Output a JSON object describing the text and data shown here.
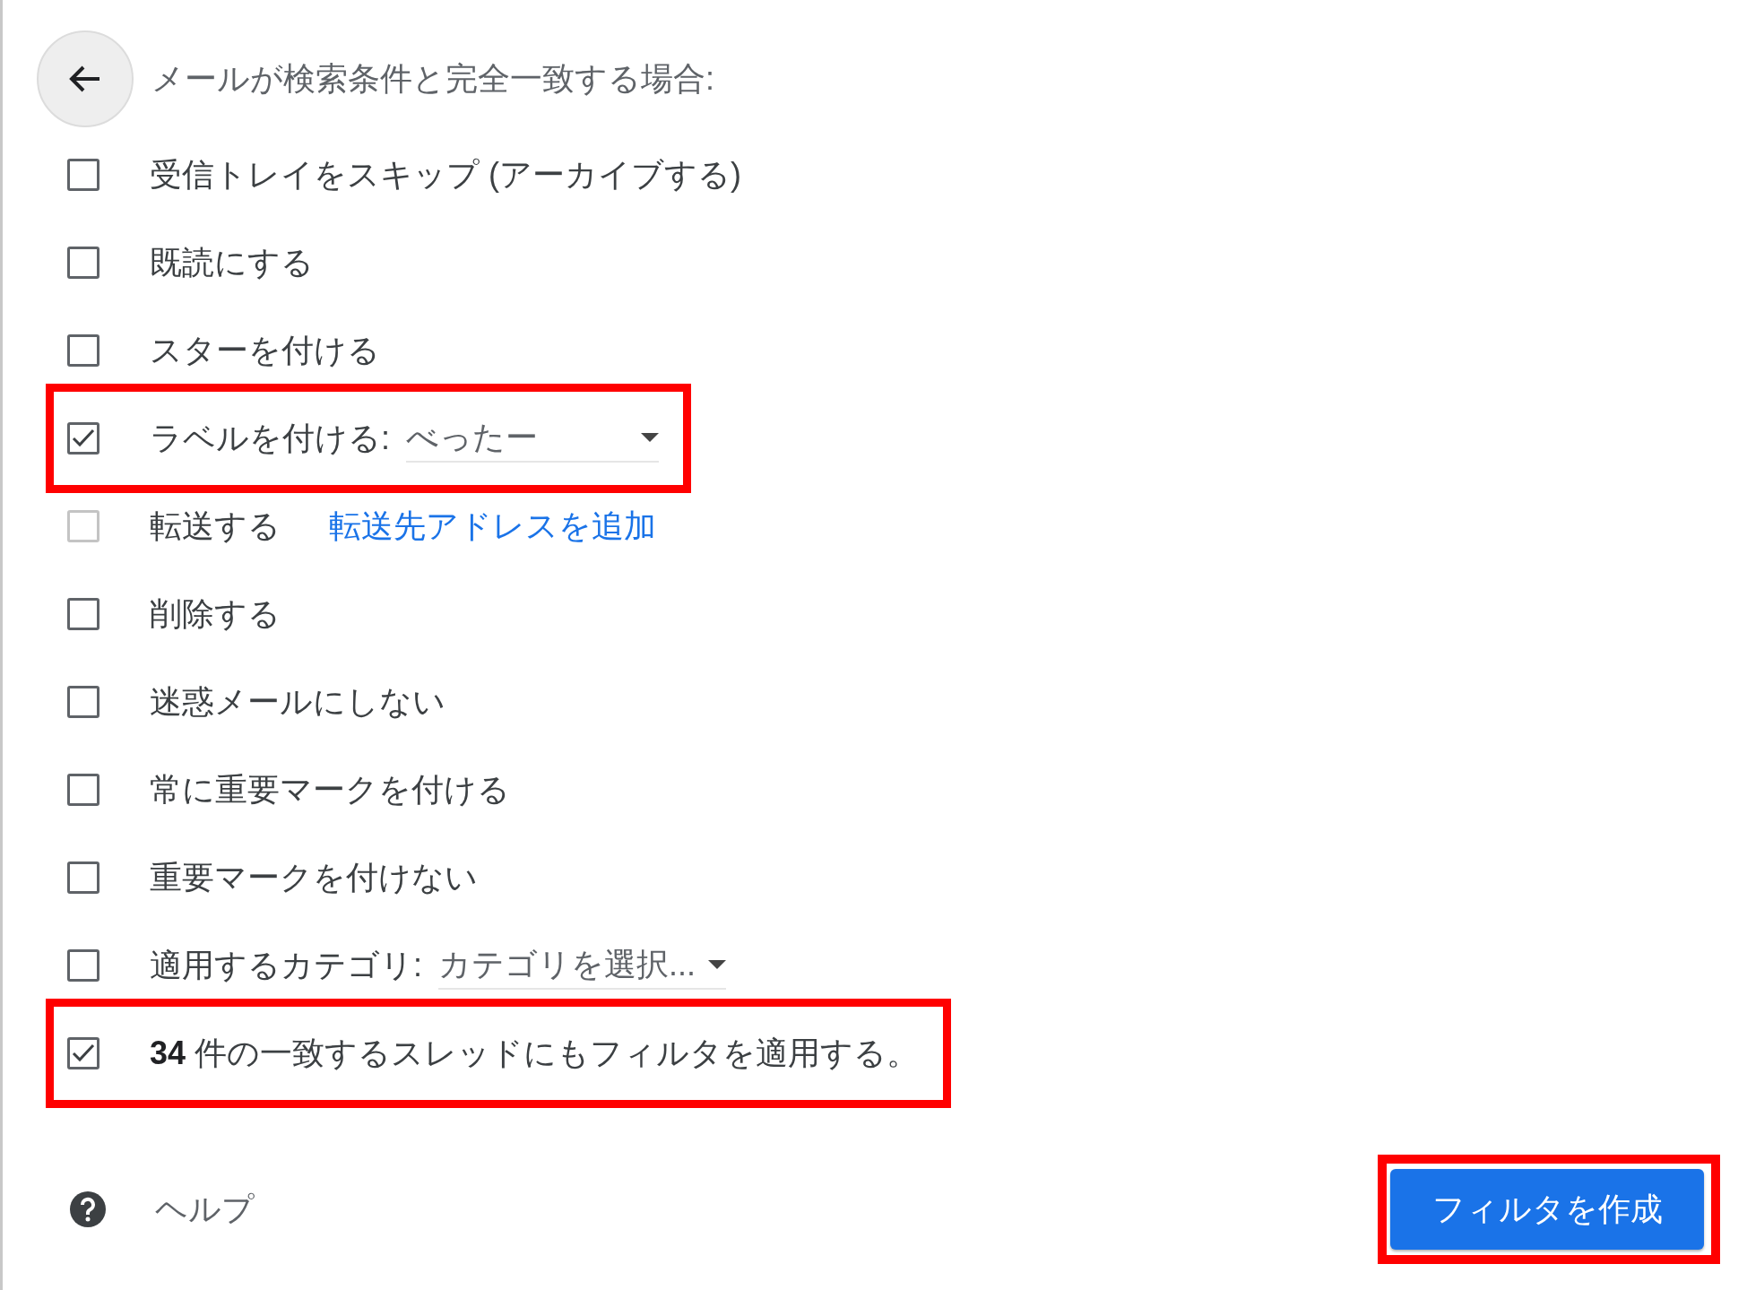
{
  "header": {
    "title": "メールが検索条件と完全一致する場合:"
  },
  "actions": [
    {
      "kind": "checkbox",
      "label": "受信トレイをスキップ (アーカイブする)",
      "checked": false,
      "disabled": false,
      "highlighted": false
    },
    {
      "kind": "checkbox",
      "label": "既読にする",
      "checked": false,
      "disabled": false,
      "highlighted": false
    },
    {
      "kind": "checkbox",
      "label": "スターを付ける",
      "checked": false,
      "disabled": false,
      "highlighted": false
    },
    {
      "kind": "select",
      "label": "ラベルを付ける:",
      "value": "べったー",
      "checked": true,
      "disabled": false,
      "highlighted": true
    },
    {
      "kind": "link",
      "label": "転送する",
      "link": "転送先アドレスを追加",
      "checked": false,
      "disabled": true,
      "highlighted": false
    },
    {
      "kind": "checkbox",
      "label": "削除する",
      "checked": false,
      "disabled": false,
      "highlighted": false
    },
    {
      "kind": "checkbox",
      "label": "迷惑メールにしない",
      "checked": false,
      "disabled": false,
      "highlighted": false
    },
    {
      "kind": "checkbox",
      "label": "常に重要マークを付ける",
      "checked": false,
      "disabled": false,
      "highlighted": false
    },
    {
      "kind": "checkbox",
      "label": "重要マークを付けない",
      "checked": false,
      "disabled": false,
      "highlighted": false
    },
    {
      "kind": "select",
      "label": "適用するカテゴリ:",
      "value": "カテゴリを選択...",
      "checked": false,
      "disabled": false,
      "highlighted": false
    },
    {
      "kind": "checkbox",
      "label": "**34** 件の一致するスレッドにもフィルタを適用する。",
      "checked": true,
      "disabled": false,
      "highlighted": true
    }
  ],
  "help": {
    "label": "ヘルプ"
  },
  "create_button": {
    "label": "フィルタを作成",
    "highlighted": true
  }
}
